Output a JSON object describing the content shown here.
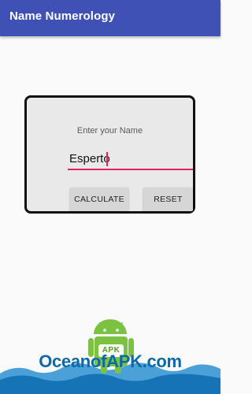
{
  "app_bar": {
    "title": "Name Numerology",
    "color": "#3f51b5"
  },
  "form": {
    "prompt": "Enter your Name",
    "name_value": "Esperto",
    "underline_color": "#e91e63",
    "calculate_label": "CALCULATE",
    "reset_label": "RESET"
  },
  "watermark": {
    "badge_text": "APK",
    "site_text": "OceanofAPK.com",
    "brand_green": "#7cc242",
    "brand_blue": "#0c69a8"
  }
}
